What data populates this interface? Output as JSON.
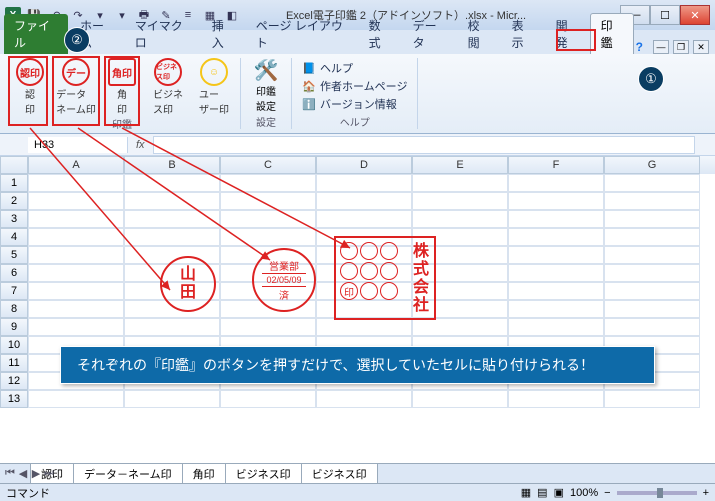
{
  "title": "Excel電子印鑑 2（アドインソフト）.xlsx - Micr...",
  "tabs": {
    "file": "ファイル",
    "items": [
      "ホーム",
      "マイマクロ",
      "挿入",
      "ページ レイアウト",
      "数式",
      "データ",
      "校閲",
      "表示",
      "開発",
      "印鑑"
    ],
    "active_index": 9
  },
  "ribbon": {
    "stamps": [
      {
        "icon": "認印",
        "label": "認\n印"
      },
      {
        "icon": "デー",
        "label": "データ\nネーム印"
      },
      {
        "icon": "角印",
        "label": "角\n印"
      },
      {
        "icon": "ビジネス印",
        "label": "ビジネ\nス印"
      },
      {
        "icon": "☺",
        "label": "ユー\nザー印"
      }
    ],
    "group_stamps_label": "印鑑",
    "config_label": "印鑑\n設定",
    "config_group_label": "設定",
    "help_items": [
      "ヘルプ",
      "作者ホームページ",
      "バージョン情報"
    ],
    "help_group_label": "ヘルプ"
  },
  "namebox": "H33",
  "columns": [
    "A",
    "B",
    "C",
    "D",
    "E",
    "F",
    "G"
  ],
  "rows": [
    1,
    2,
    3,
    4,
    5,
    6,
    7,
    8,
    9,
    10,
    11,
    12,
    13
  ],
  "stamp_examples": {
    "round_name": "山\n田",
    "date_top": "営業部",
    "date_mid": "02/05/09",
    "date_bot": "済",
    "square_text": "株式会社",
    "square_bottom": "印"
  },
  "callout": "それぞれの『印鑑』のボタンを押すだけで、選択していたセルに貼り付けられる！",
  "sheet_tabs": [
    "認印",
    "データ－ネーム印",
    "角印",
    "ビジネス印",
    "ビジネス印"
  ],
  "status": {
    "label": "コマンド",
    "zoom": "100%"
  },
  "badges": {
    "one": "①",
    "two": "②"
  }
}
